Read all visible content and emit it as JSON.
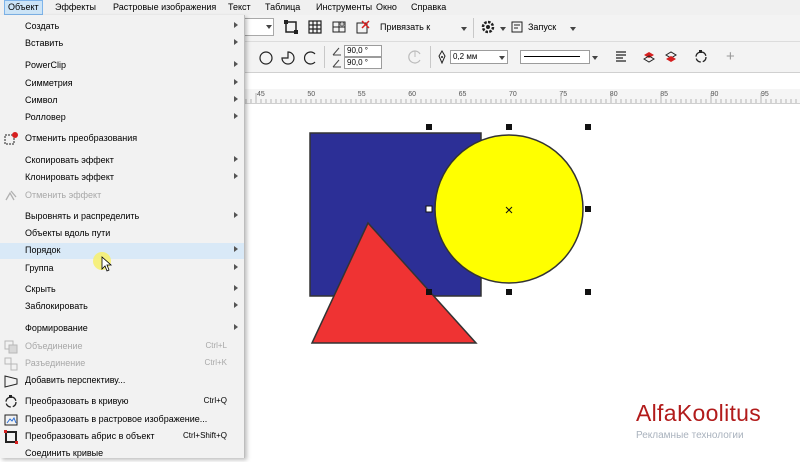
{
  "menubar": {
    "items": [
      "Объект",
      "Эффекты",
      "Растровые изображения",
      "Текст",
      "Таблица",
      "Инструменты",
      "Окно",
      "Справка"
    ],
    "active_index": 0
  },
  "toolbar": {
    "snap_label": "Привязать к",
    "launch_label": "Запуск"
  },
  "propbar": {
    "angle_top": "90,0 °",
    "angle_bottom": "90,0 °",
    "outline_width": "0,2 мм"
  },
  "ruler": {
    "labels": [
      "45",
      "50",
      "55",
      "60",
      "65",
      "70",
      "75",
      "80",
      "85",
      "90",
      "95"
    ]
  },
  "menu": {
    "items": [
      {
        "label": "Создать",
        "arrow": true
      },
      {
        "label": "Вставить",
        "arrow": true
      },
      {
        "label": "PowerClip",
        "arrow": true
      },
      {
        "label": "Симметрия",
        "arrow": true
      },
      {
        "label": "Символ",
        "arrow": true
      },
      {
        "label": "Ролловер",
        "arrow": true
      },
      {
        "label": "Отменить преобразования",
        "icon": "undo-transform-icon"
      },
      {
        "label": "Скопировать эффект",
        "arrow": true
      },
      {
        "label": "Клонировать эффект",
        "arrow": true
      },
      {
        "label": "Отменить эффект",
        "disabled": true,
        "icon": "clear-effect-icon"
      },
      {
        "label": "Выровнять и распределить",
        "arrow": true
      },
      {
        "label": "Объекты вдоль пути"
      },
      {
        "label": "Порядок",
        "arrow": true,
        "highlighted": true
      },
      {
        "label": "Группа",
        "arrow": true
      },
      {
        "label": "Скрыть",
        "arrow": true
      },
      {
        "label": "Заблокировать",
        "arrow": true
      },
      {
        "label": "Формирование",
        "arrow": true
      },
      {
        "label": "Объединение",
        "shortcut": "Ctrl+L",
        "disabled": true,
        "icon": "combine-icon"
      },
      {
        "label": "Разъединение",
        "shortcut": "Ctrl+K",
        "disabled": true,
        "icon": "break-apart-icon"
      },
      {
        "label": "Добавить перспективу...",
        "icon": "perspective-icon"
      },
      {
        "label": "Преобразовать в кривую",
        "shortcut": "Ctrl+Q",
        "icon": "convert-to-curves-icon"
      },
      {
        "label": "Преобразовать в растровое изображение...",
        "icon": "convert-to-bitmap-icon"
      },
      {
        "label": "Преобразовать абрис в объект",
        "shortcut": "Ctrl+Shift+Q",
        "icon": "outline-to-object-icon"
      },
      {
        "label": "Соединить кривые"
      }
    ]
  },
  "shapes": {
    "square_color": "#2c2f96",
    "circle_color": "#ffff00",
    "triangle_color": "#ef3333",
    "outline_color": "#333333"
  },
  "watermark": {
    "title": "AlfaKoolitus",
    "subtitle": "Рекламные технологии"
  }
}
